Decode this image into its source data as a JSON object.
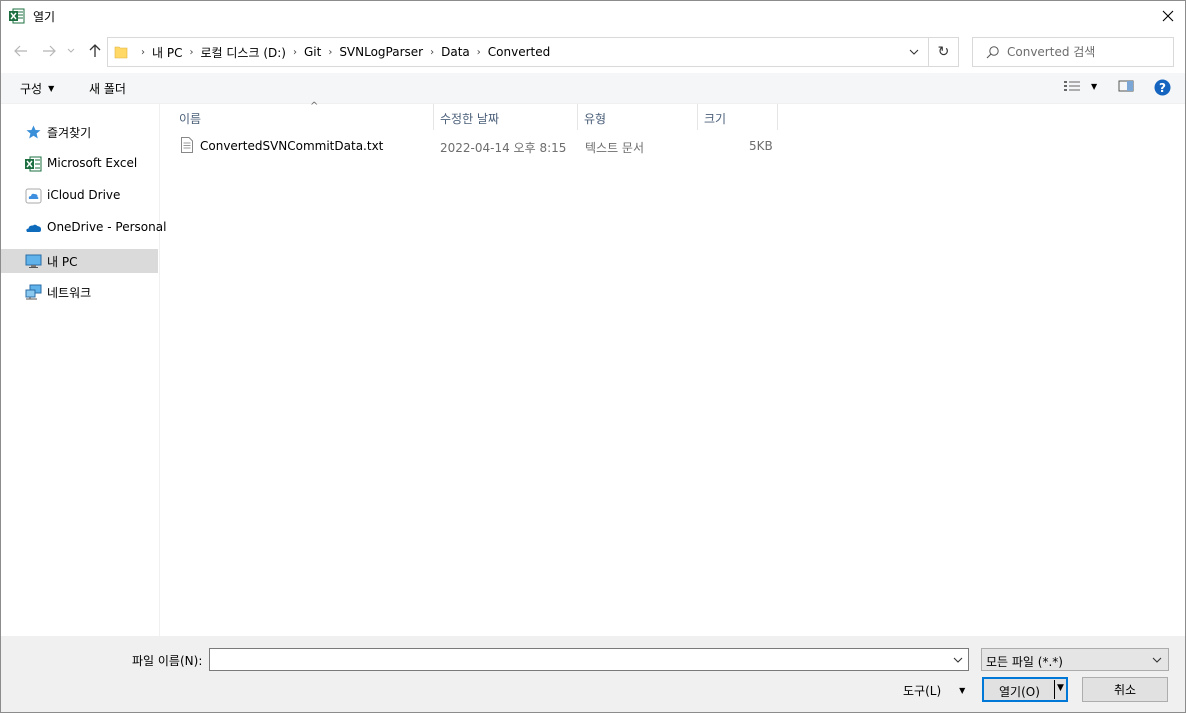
{
  "window": {
    "title": "열기",
    "close_glyph": "✕"
  },
  "nav": {
    "back_glyph": "←",
    "forward_glyph": "→",
    "recent_glyph": "⌄",
    "up_glyph": "↑",
    "refresh_glyph": "↻",
    "breadcrumbs": [
      "내 PC",
      "로컬 디스크 (D:)",
      "Git",
      "SVNLogParser",
      "Data",
      "Converted"
    ]
  },
  "search": {
    "placeholder": "Converted 검색"
  },
  "toolbar": {
    "organize_label": "구성",
    "new_folder_label": "새 폴더"
  },
  "sidebar": {
    "items": [
      {
        "label": "즐겨찾기",
        "icon": "star-icon"
      },
      {
        "label": "Microsoft Excel",
        "icon": "excel-icon"
      },
      {
        "label": "iCloud Drive",
        "icon": "icloud-icon"
      },
      {
        "label": "OneDrive - Personal",
        "icon": "onedrive-icon"
      },
      {
        "label": "내 PC",
        "icon": "pc-icon",
        "selected": true
      },
      {
        "label": "네트워크",
        "icon": "network-icon"
      }
    ]
  },
  "columns": {
    "name": "이름",
    "modified": "수정한 날짜",
    "type": "유형",
    "size": "크기"
  },
  "files": [
    {
      "name": "ConvertedSVNCommitData.txt",
      "modified": "2022-04-14 오후 8:15",
      "type": "텍스트 문서",
      "size": "5KB"
    }
  ],
  "bottom": {
    "filename_label": "파일 이름(N):",
    "filename_value": "",
    "filetype_value": "모든 파일 (*.*)",
    "tools_label": "도구(L)",
    "open_label": "열기(O)",
    "cancel_label": "취소"
  },
  "colors": {
    "accent": "#0078d7",
    "selected_bg": "#dadada",
    "excel_green": "#1d6f42",
    "help_blue": "#1565c0"
  }
}
